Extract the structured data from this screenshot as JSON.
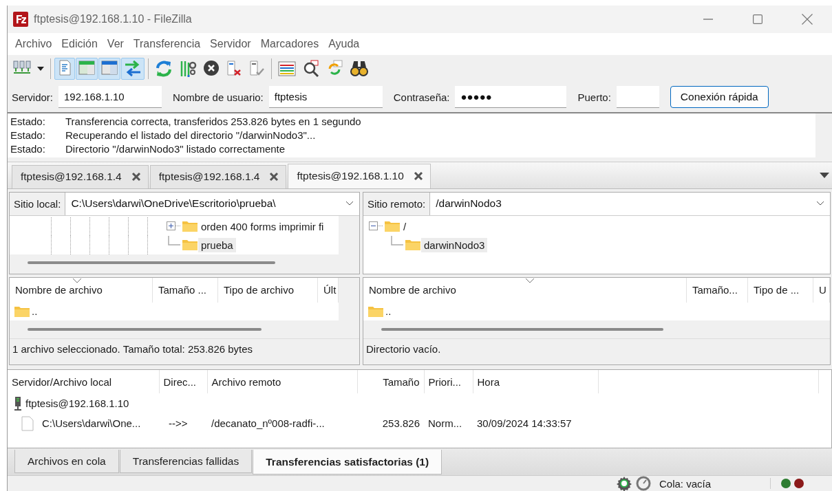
{
  "window": {
    "title": "ftptesis@192.168.1.10 - FileZilla"
  },
  "menu": [
    "Archivo",
    "Edición",
    "Ver",
    "Transferencia",
    "Servidor",
    "Marcadores",
    "Ayuda"
  ],
  "toolbar": [
    [
      {
        "kind": "sitemanager"
      },
      {
        "kind": "dropdown"
      }
    ],
    [
      {
        "kind": "log",
        "on": true
      },
      {
        "kind": "localtree",
        "on": true
      },
      {
        "kind": "remotetree",
        "on": true
      },
      {
        "kind": "queue",
        "on": true
      }
    ],
    [
      {
        "kind": "refresh"
      },
      {
        "kind": "filter"
      },
      {
        "kind": "cancel"
      },
      {
        "kind": "disconnect"
      },
      {
        "kind": "reconnect"
      }
    ],
    [
      {
        "kind": "compare"
      },
      {
        "kind": "search"
      },
      {
        "kind": "sync"
      },
      {
        "kind": "find"
      }
    ]
  ],
  "quickconnect": {
    "fields": [
      {
        "label": "Servidor:",
        "value": "192.168.1.10",
        "kind": "host"
      },
      {
        "label": "Nombre de usuario:",
        "value": "ftptesis",
        "kind": "user"
      },
      {
        "label": "Contraseña:",
        "value": "●●●●●",
        "kind": "password"
      },
      {
        "label": "Puerto:",
        "kind": "port"
      }
    ],
    "button": "Conexión rápida"
  },
  "log": [
    {
      "label": "Estado:",
      "text": "Transferencia correcta, transferidos 253.826 bytes en 1 segundo"
    },
    {
      "label": "Estado:",
      "text": "Recuperando el listado del directorio \"/darwinNodo3\"..."
    },
    {
      "label": "Estado:",
      "text": "Directorio \"/darwinNodo3\" listado correctamente"
    }
  ],
  "tabs": [
    {
      "label": "ftptesis@192.168.1.4",
      "selected": false
    },
    {
      "label": "ftptesis@192.168.1.4",
      "selected": false
    },
    {
      "label": "ftptesis@192.168.1.10",
      "selected": true
    }
  ],
  "local": {
    "site_label": "Sitio local:",
    "path": "C:\\Users\\darwi\\OneDrive\\Escritorio\\prueba\\",
    "tree": [
      {
        "label": "orden 400 forms imprimir fi",
        "kind": "collapsed",
        "selected": false
      },
      {
        "label": "prueba",
        "kind": "leaf",
        "selected": true
      }
    ],
    "columns": [
      "Nombre de archivo",
      "Tamaño ...",
      "Tipo de archivo",
      "Últ"
    ],
    "rows": [
      {
        "name": ".."
      }
    ],
    "status": "1 archivo seleccionado. Tamaño total: 253.826 bytes"
  },
  "remote": {
    "site_label": "Sitio remoto:",
    "path": "/darwinNodo3",
    "tree": [
      {
        "label": "/",
        "kind": "expanded",
        "selected": false,
        "children": [
          {
            "label": "darwinNodo3",
            "kind": "leaf",
            "selected": true
          }
        ]
      }
    ],
    "columns": [
      "Nombre de archivo",
      "Tamaño...",
      "Tipo de ...",
      "U"
    ],
    "rows": [
      {
        "name": ".."
      }
    ],
    "status": "Directorio vacío."
  },
  "queue": {
    "columns": [
      "Servidor/Archivo local",
      "Direc...",
      "Archivo remoto",
      "Tamaño",
      "Priori...",
      "Hora"
    ],
    "server": "ftptesis@192.168.1.10",
    "files": [
      [
        "C:\\Users\\darwi\\One...",
        "-->>",
        "/decanato_nº008-radfi-...",
        "253.826",
        "Norm...",
        "30/09/2024 14:33:57"
      ]
    ]
  },
  "bottom_tabs": [
    {
      "label": "Archivos en cola",
      "selected": false
    },
    {
      "label": "Transferencias fallidas",
      "selected": false
    },
    {
      "label": "Transferencias satisfactorias (1)",
      "selected": true
    }
  ],
  "status_bar": {
    "queue": "Cola: vacía"
  }
}
